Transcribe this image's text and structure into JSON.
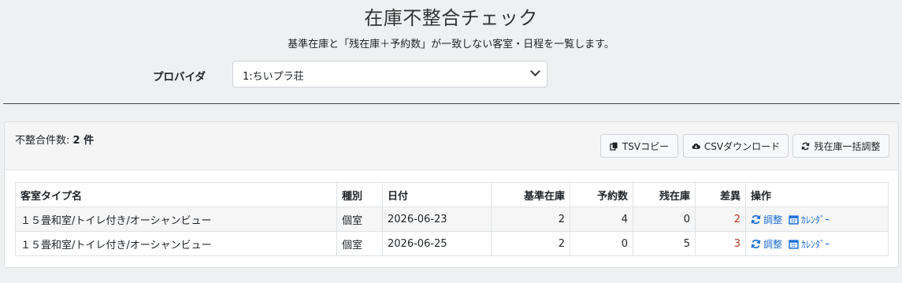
{
  "header": {
    "title": "在庫不整合チェック",
    "description": "基準在庫と「残在庫＋予約数」が一致しない客室・日程を一覧します。"
  },
  "provider": {
    "label": "プロバイダ",
    "selected": "1:ちいプラ荘"
  },
  "summary": {
    "count_label": "不整合件数:",
    "count_value": "2 件"
  },
  "toolbar": {
    "tsv_copy": "TSVコピー",
    "csv_download": "CSVダウンロード",
    "bulk_adjust": "残在庫一括調整"
  },
  "table": {
    "columns": [
      "客室タイプ名",
      "種別",
      "日付",
      "基準在庫",
      "予約数",
      "残在庫",
      "差異",
      "操作"
    ],
    "rows": [
      {
        "room_type": "１５畳和室/トイレ付き/オーシャンビュー",
        "kind": "個室",
        "date": "2026-06-23",
        "base_stock": "2",
        "reservations": "4",
        "remaining": "0",
        "diff": "2",
        "adjust": "調整",
        "calendar": "ｶﾚﾝﾀﾞｰ"
      },
      {
        "room_type": "１５畳和室/トイレ付き/オーシャンビュー",
        "kind": "個室",
        "date": "2026-06-25",
        "base_stock": "2",
        "reservations": "0",
        "remaining": "5",
        "diff": "3",
        "adjust": "調整",
        "calendar": "ｶﾚﾝﾀﾞｰ"
      }
    ]
  },
  "colors": {
    "accent": "#1e6fd9",
    "diff": "#c0392b",
    "background": "#eef0f2"
  },
  "icons": {
    "tsv_copy": "copy-icon",
    "csv_download": "cloud-download-icon",
    "bulk_adjust": "sync-icon",
    "adjust": "sync-icon",
    "calendar": "calendar-icon"
  }
}
